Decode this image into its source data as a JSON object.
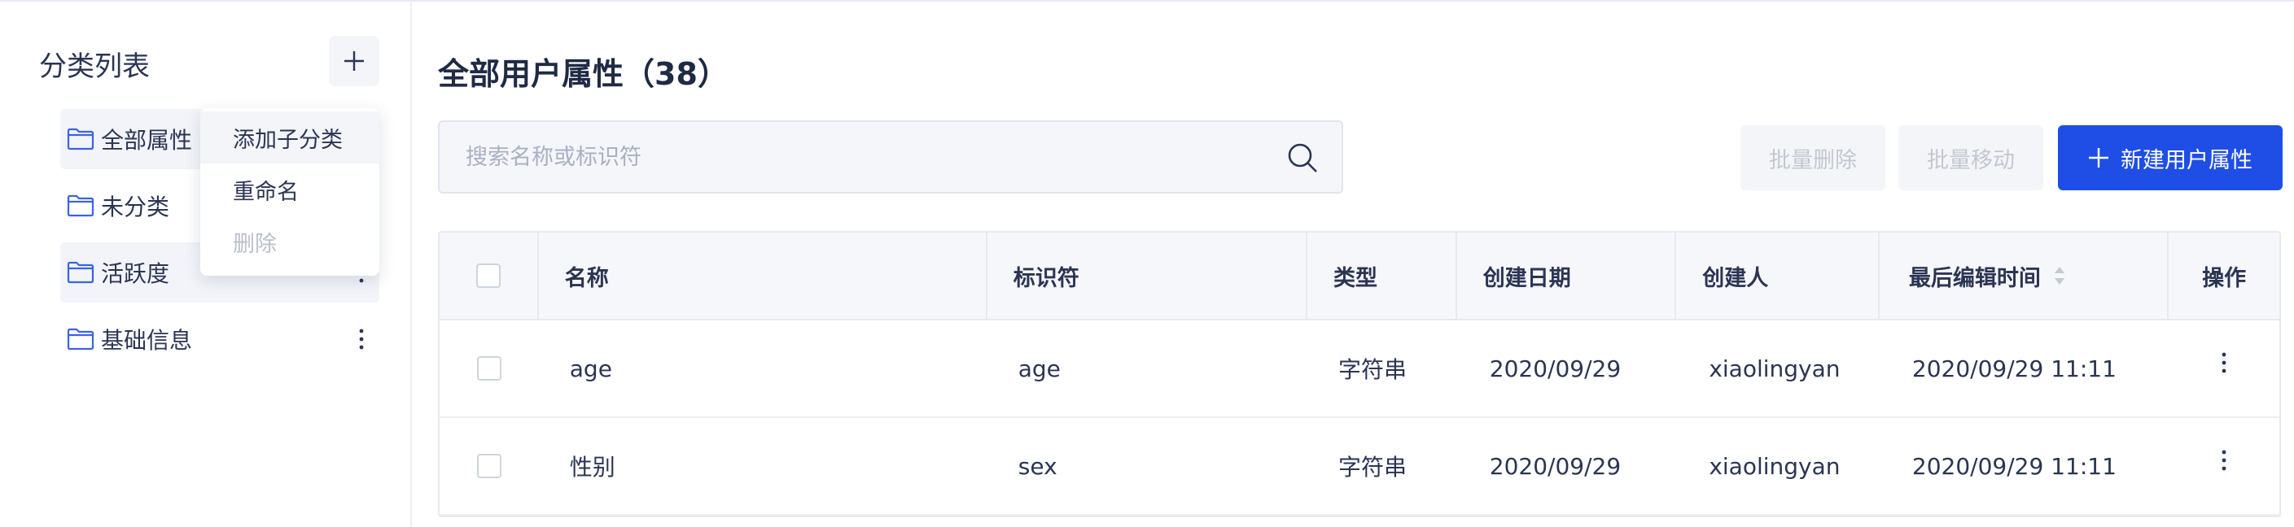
{
  "sidebar": {
    "title": "分类列表",
    "items": [
      {
        "label": "全部属性",
        "active": true
      },
      {
        "label": "未分类",
        "active": false
      },
      {
        "label": "活跃度",
        "active": true
      },
      {
        "label": "基础信息",
        "active": false
      }
    ]
  },
  "context_menu": {
    "items": [
      {
        "label": "添加子分类",
        "state": "hover"
      },
      {
        "label": "重命名",
        "state": "normal"
      },
      {
        "label": "删除",
        "state": "disabled"
      }
    ]
  },
  "main": {
    "title": "全部用户属性（38）",
    "search": {
      "placeholder": "搜索名称或标识符",
      "value": ""
    },
    "buttons": {
      "batch_delete": "批量删除",
      "batch_move": "批量移动",
      "create": "新建用户属性"
    }
  },
  "table": {
    "columns": [
      "名称",
      "标识符",
      "类型",
      "创建日期",
      "创建人",
      "最后编辑时间",
      "操作"
    ],
    "rows": [
      {
        "name": "age",
        "id": "age",
        "type": "字符串",
        "created": "2020/09/29",
        "creator": "xiaolingyan",
        "edited": "2020/09/29 11:11"
      },
      {
        "name": "性别",
        "id": "sex",
        "type": "字符串",
        "created": "2020/09/29",
        "creator": "xiaolingyan",
        "edited": "2020/09/29 11:11"
      }
    ]
  },
  "colors": {
    "primary": "#1f4ee6",
    "folder": "#3a63e6",
    "text": "#2b3553"
  },
  "icons": {
    "add": "plus-icon",
    "folder": "folder-icon",
    "more": "more-vertical-icon",
    "search": "search-icon",
    "sort": "sort-icon"
  }
}
